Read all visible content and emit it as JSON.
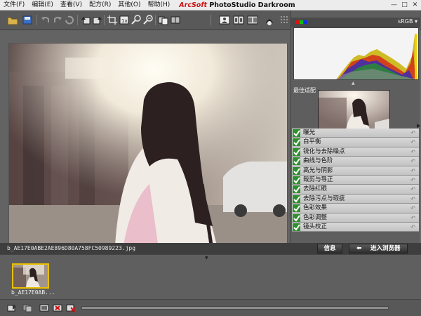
{
  "menubar": {
    "items": [
      "文件(F)",
      "编辑(E)",
      "查看(V)",
      "配方(R)",
      "其他(O)",
      "帮助(H)"
    ],
    "brand": "ArcSoft",
    "product": "PhotoStudio Darkroom"
  },
  "toolbar": {
    "icons": [
      "open-icon",
      "save-icon",
      "undo-icon",
      "redo-icon",
      "refresh-icon",
      "rotate-left-icon",
      "rotate-right-icon",
      "crop-icon",
      "resize-icon",
      "zoom-in-icon",
      "zoom-out-icon",
      "compare-icon",
      "split-icon",
      "view-single-icon",
      "view-split-icon",
      "view-dual-icon",
      "overexposure-icon",
      "grid-icon"
    ]
  },
  "histogram": {
    "color_space": "sRGB"
  },
  "preset": {
    "label": "最佳适配"
  },
  "adjustments": [
    {
      "label": "曝光"
    },
    {
      "label": "白平衡"
    },
    {
      "label": "锐化与去除噪点"
    },
    {
      "label": "曲线与色阶"
    },
    {
      "label": "高光与阴影"
    },
    {
      "label": "裁剪与导正"
    },
    {
      "label": "去除红眼"
    },
    {
      "label": "去除污点与瑕疵"
    },
    {
      "label": "色彩效果"
    },
    {
      "label": "色彩调整"
    },
    {
      "label": "镜头校正"
    }
  ],
  "infobar": {
    "filename": "b_AE17E0ABE2AE896D80A758FC50989223.jpg",
    "info_button": "信息",
    "browser_button": "进入浏览器"
  },
  "filmstrip": {
    "thumb_label": "b_AE17E0AB..."
  },
  "colors": {
    "accent_yellow": "#e8c000",
    "brand_red": "#cc1111",
    "check_green": "#2f8e2f"
  }
}
